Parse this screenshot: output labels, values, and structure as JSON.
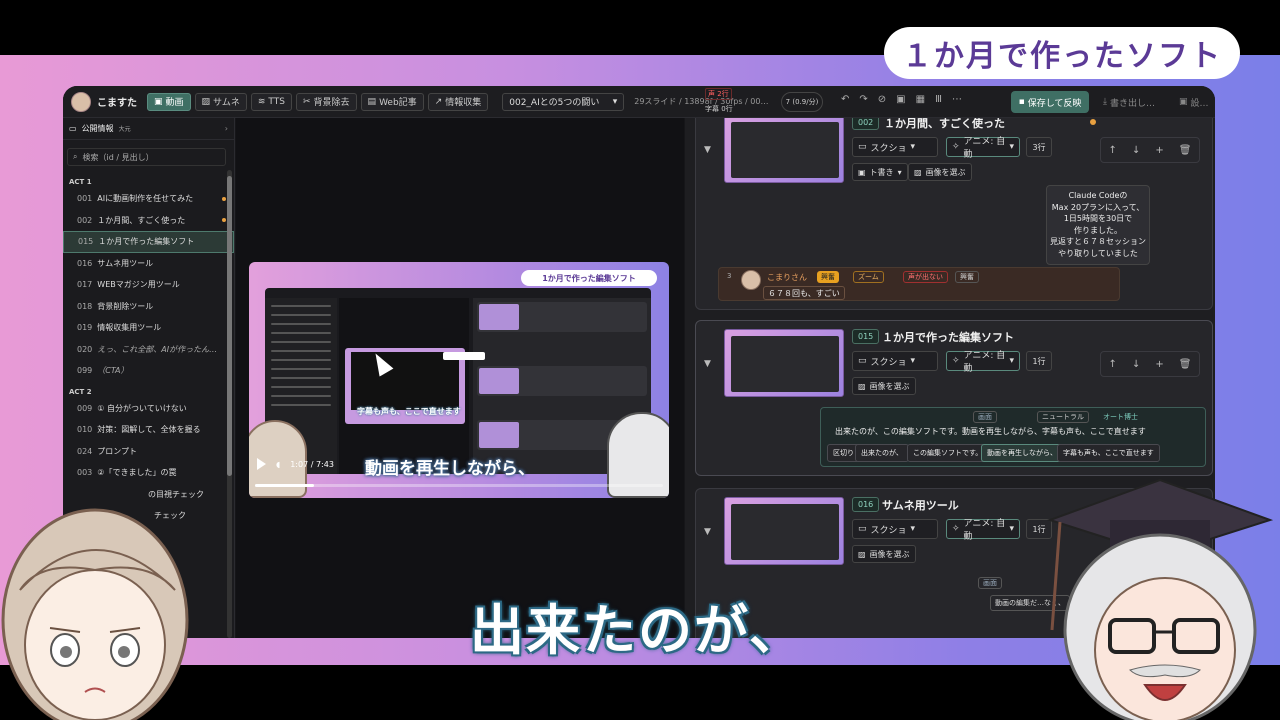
{
  "overlay": {
    "title_pill": "１か月で作ったソフト",
    "main_subtitle": "出来たのが、"
  },
  "topbar": {
    "app_name": "こますた",
    "tabs": [
      {
        "label": "動画",
        "icon": "film-icon",
        "active": true
      },
      {
        "label": "サムネ",
        "icon": "image-icon",
        "active": false
      },
      {
        "label": "TTS",
        "icon": "audio-icon",
        "active": false
      },
      {
        "label": "背景除去",
        "icon": "scissors-icon",
        "active": false
      },
      {
        "label": "Web記事",
        "icon": "document-icon",
        "active": false
      },
      {
        "label": "情報収集",
        "icon": "trend-icon",
        "active": false
      }
    ],
    "project_select": "002_AIとの5つの闘い",
    "project_info": "29スライド / 13898f / 30fps / 00…",
    "status_warn": "声 2行",
    "status_ok": "字幕 0行",
    "counter_value": "7",
    "counter_sub": "(0.9/分)",
    "save_label": "保存して反映",
    "export_label": "書き出し…",
    "export2_label": "設…"
  },
  "sidebar": {
    "header_label": "公開情報",
    "header_badge": "大元",
    "search_placeholder": "検索（id / 見出し）",
    "acts": [
      {
        "label": "ACT 1",
        "items": [
          {
            "num": "001",
            "label": "AIに動画制作を任せてみた",
            "dot": true
          },
          {
            "num": "002",
            "label": "１か月間、すごく使った",
            "dot": true
          },
          {
            "num": "015",
            "label": "１か月で作った編集ソフト",
            "selected": true
          },
          {
            "num": "016",
            "label": "サムネ用ツール"
          },
          {
            "num": "017",
            "label": "WEBマガジン用ツール"
          },
          {
            "num": "018",
            "label": "背景削除ツール"
          },
          {
            "num": "019",
            "label": "情報収集用ツール"
          },
          {
            "num": "020",
            "label": "えっ、これ全部、AIが作ったん…",
            "dim": true
          },
          {
            "num": "099",
            "label": "（CTA）",
            "dim": true
          }
        ]
      },
      {
        "label": "ACT 2",
        "items": [
          {
            "num": "009",
            "label": "① 自分がついていけない"
          },
          {
            "num": "010",
            "label": "対策：図解して、全体を握る"
          },
          {
            "num": "024",
            "label": "プロンプト"
          },
          {
            "num": "003",
            "label": "②「できました」の罠"
          },
          {
            "num": "",
            "label": "の目視チェック"
          },
          {
            "num": "",
            "label": "チェック"
          }
        ]
      }
    ]
  },
  "preview": {
    "pill": "1か月で作った編集ソフト",
    "inner_subtitle": "字幕も声も、ここで直せます",
    "subtitle": "動画を再生しながら、",
    "time": "1:07 / 7:43",
    "progress": 0.145
  },
  "scenes": [
    {
      "id": "002",
      "title": "１か月間、すごく使った",
      "type_select": "スクショ",
      "anim_select": "アニメ: 自動",
      "lines": "3行",
      "extra_select": "ト書き",
      "image_button": "画像を選ぶ",
      "bubble_lines": [
        "Claude Codeの",
        "Max 20プランに入って、",
        "1日5時間を30日で",
        "作りました。",
        "見返すと６７８セッション",
        "やり取りしていました"
      ],
      "line_row": {
        "num": "3",
        "speaker": "こまりさん",
        "chip_surprise": "興奮",
        "chip_zoom": "ズーム",
        "chip_mute": "声が出ない",
        "chip_extra": "興奮",
        "text": "６７８回も、すごい"
      }
    },
    {
      "id": "015",
      "title": "１か月で作った編集ソフト",
      "type_select": "スクショ",
      "anim_select": "アニメ: 自動",
      "lines": "1行",
      "image_button": "画像を選ぶ",
      "sub_row": {
        "display": "画面",
        "tone": "ニュートラル",
        "speaker": "オート博士",
        "full_text": "出来たのが、この編集ソフトです。動画を再生しながら、字幕も声も、ここで直せます",
        "segments": [
          "区切り",
          "出来たのが、",
          "この編集ソフトです。",
          "動画を再生しながら、",
          "字幕も声も、ここで直せます"
        ]
      }
    },
    {
      "id": "016",
      "title": "サムネ用ツール",
      "type_select": "スクショ",
      "anim_select": "アニメ: 自動",
      "lines": "1行",
      "image_button": "画像を選ぶ",
      "bottom_display": "画面",
      "bottom_text": "動画の編集だ…なく、"
    }
  ]
}
